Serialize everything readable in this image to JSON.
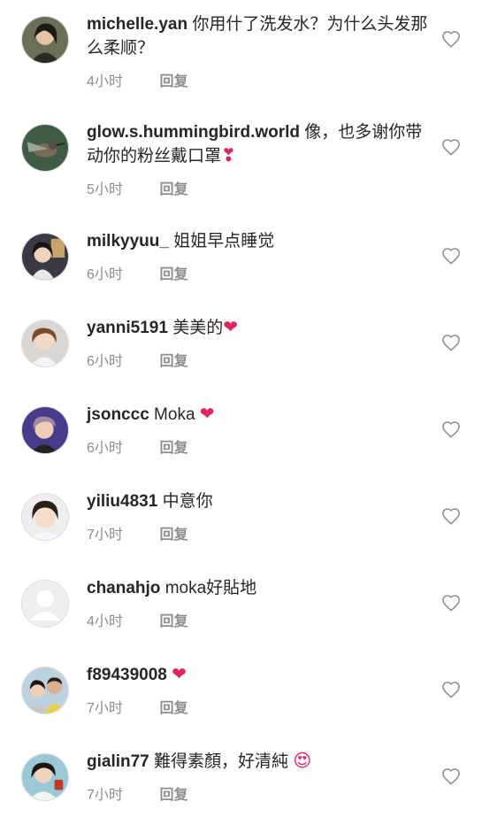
{
  "comments": [
    {
      "username": "michelle.yan",
      "text": "你用什了洗发水？为什么头发那么柔顺？",
      "time": "4小时",
      "reply": "回复",
      "emoji": ""
    },
    {
      "username": "glow.s.hummingbird.world",
      "text": "像，也多谢你带动你的粉丝戴口罩",
      "time": "5小时",
      "reply": "回复",
      "emoji": "❣"
    },
    {
      "username": "milkyyuu_",
      "text": "姐姐早点睡觉",
      "time": "6小时",
      "reply": "回复",
      "emoji": ""
    },
    {
      "username": "yanni5191",
      "text": "美美的",
      "time": "6小时",
      "reply": "回复",
      "emoji": "❤"
    },
    {
      "username": "jsonccc",
      "text": "Moka",
      "time": "6小时",
      "reply": "回复",
      "emoji": "❤"
    },
    {
      "username": "yiliu4831",
      "text": "中意你",
      "time": "7小时",
      "reply": "回复",
      "emoji": ""
    },
    {
      "username": "chanahjo",
      "text": "moka好貼地",
      "time": "4小时",
      "reply": "回复",
      "emoji": ""
    },
    {
      "username": "f89439008",
      "text": "",
      "time": "7小时",
      "reply": "回复",
      "emoji": "❤"
    },
    {
      "username": "gialin77",
      "text": "難得素顏，好清純",
      "time": "7小时",
      "reply": "回复",
      "emoji": "😍"
    }
  ],
  "colors": {
    "username": "#262626",
    "meta": "#8e8e8e",
    "heart": "#e0245e",
    "like_outline": "#8e8e8e"
  },
  "icons": {
    "like": "heart-outline-icon",
    "avatar": "user-avatar"
  }
}
